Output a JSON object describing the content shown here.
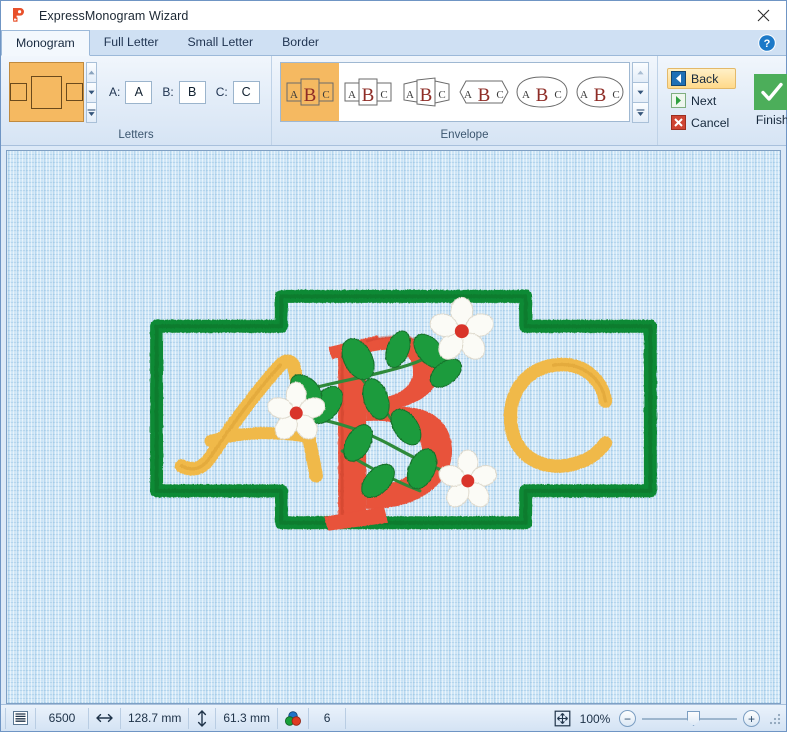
{
  "window": {
    "title": "ExpressMonogram Wizard",
    "app_icon": "expressmonogram-logo-icon",
    "close_icon": "close-icon"
  },
  "tabs": [
    {
      "label": "Monogram",
      "active": true
    },
    {
      "label": "Full Letter",
      "active": false
    },
    {
      "label": "Small Letter",
      "active": false
    },
    {
      "label": "Border",
      "active": false
    }
  ],
  "help": {
    "icon": "help-question-icon",
    "label": "?"
  },
  "ribbon": {
    "letters": {
      "group_label": "Letters",
      "layout_preview_name": "monogram-layout-preview",
      "spin_up": "▲",
      "spin_down": "▼",
      "spin_more": "▼",
      "fields": [
        {
          "label": "A:",
          "value": "A"
        },
        {
          "label": "B:",
          "value": "B"
        },
        {
          "label": "C:",
          "value": "C"
        }
      ]
    },
    "envelope": {
      "group_label": "Envelope",
      "selected_index": 0,
      "items": [
        {
          "name": "envelope-style-1",
          "shape": "rect",
          "selected": true
        },
        {
          "name": "envelope-style-2",
          "shape": "rect",
          "selected": false
        },
        {
          "name": "envelope-style-3",
          "shape": "slant",
          "selected": false
        },
        {
          "name": "envelope-style-4",
          "shape": "hex",
          "selected": false
        },
        {
          "name": "envelope-style-5",
          "shape": "oval-wide",
          "selected": false
        },
        {
          "name": "envelope-style-6",
          "shape": "oval",
          "selected": false
        }
      ],
      "letters": [
        "A",
        "B",
        "C"
      ],
      "spin_up": "▲",
      "spin_down": "▼",
      "spin_more": "▼"
    },
    "nav": {
      "back": "Back",
      "next": "Next",
      "cancel": "Cancel",
      "finish": "Finish",
      "back_hovered": true
    }
  },
  "design": {
    "letters": {
      "left": "A",
      "center": "B",
      "right": "C"
    },
    "colors": {
      "border": "#0e8a35",
      "border_dark": "#0a6b28",
      "letter_gold": "#f0b94a",
      "letter_gold_dark": "#d29a2e",
      "letter_red": "#e8523b",
      "letter_red_dark": "#c33d2a",
      "leaf_green": "#1f9b3c",
      "stem_green": "#2f8a3a",
      "flower_white": "#fbfbf6",
      "flower_center": "#d9342a",
      "fabric": "#cfe6f7"
    }
  },
  "statusbar": {
    "stitches_icon": "stitch-count-icon",
    "stitches": "6500",
    "width_icon": "width-arrow-icon",
    "width": "128.7 mm",
    "height_icon": "height-arrow-icon",
    "height": "61.3 mm",
    "colors_icon": "color-count-icon",
    "colors": "6",
    "fit_icon": "fit-to-window-icon",
    "zoom_level": "100%",
    "zoom_out": "−",
    "zoom_in": "+",
    "grip_icon": "resize-grip-icon"
  }
}
